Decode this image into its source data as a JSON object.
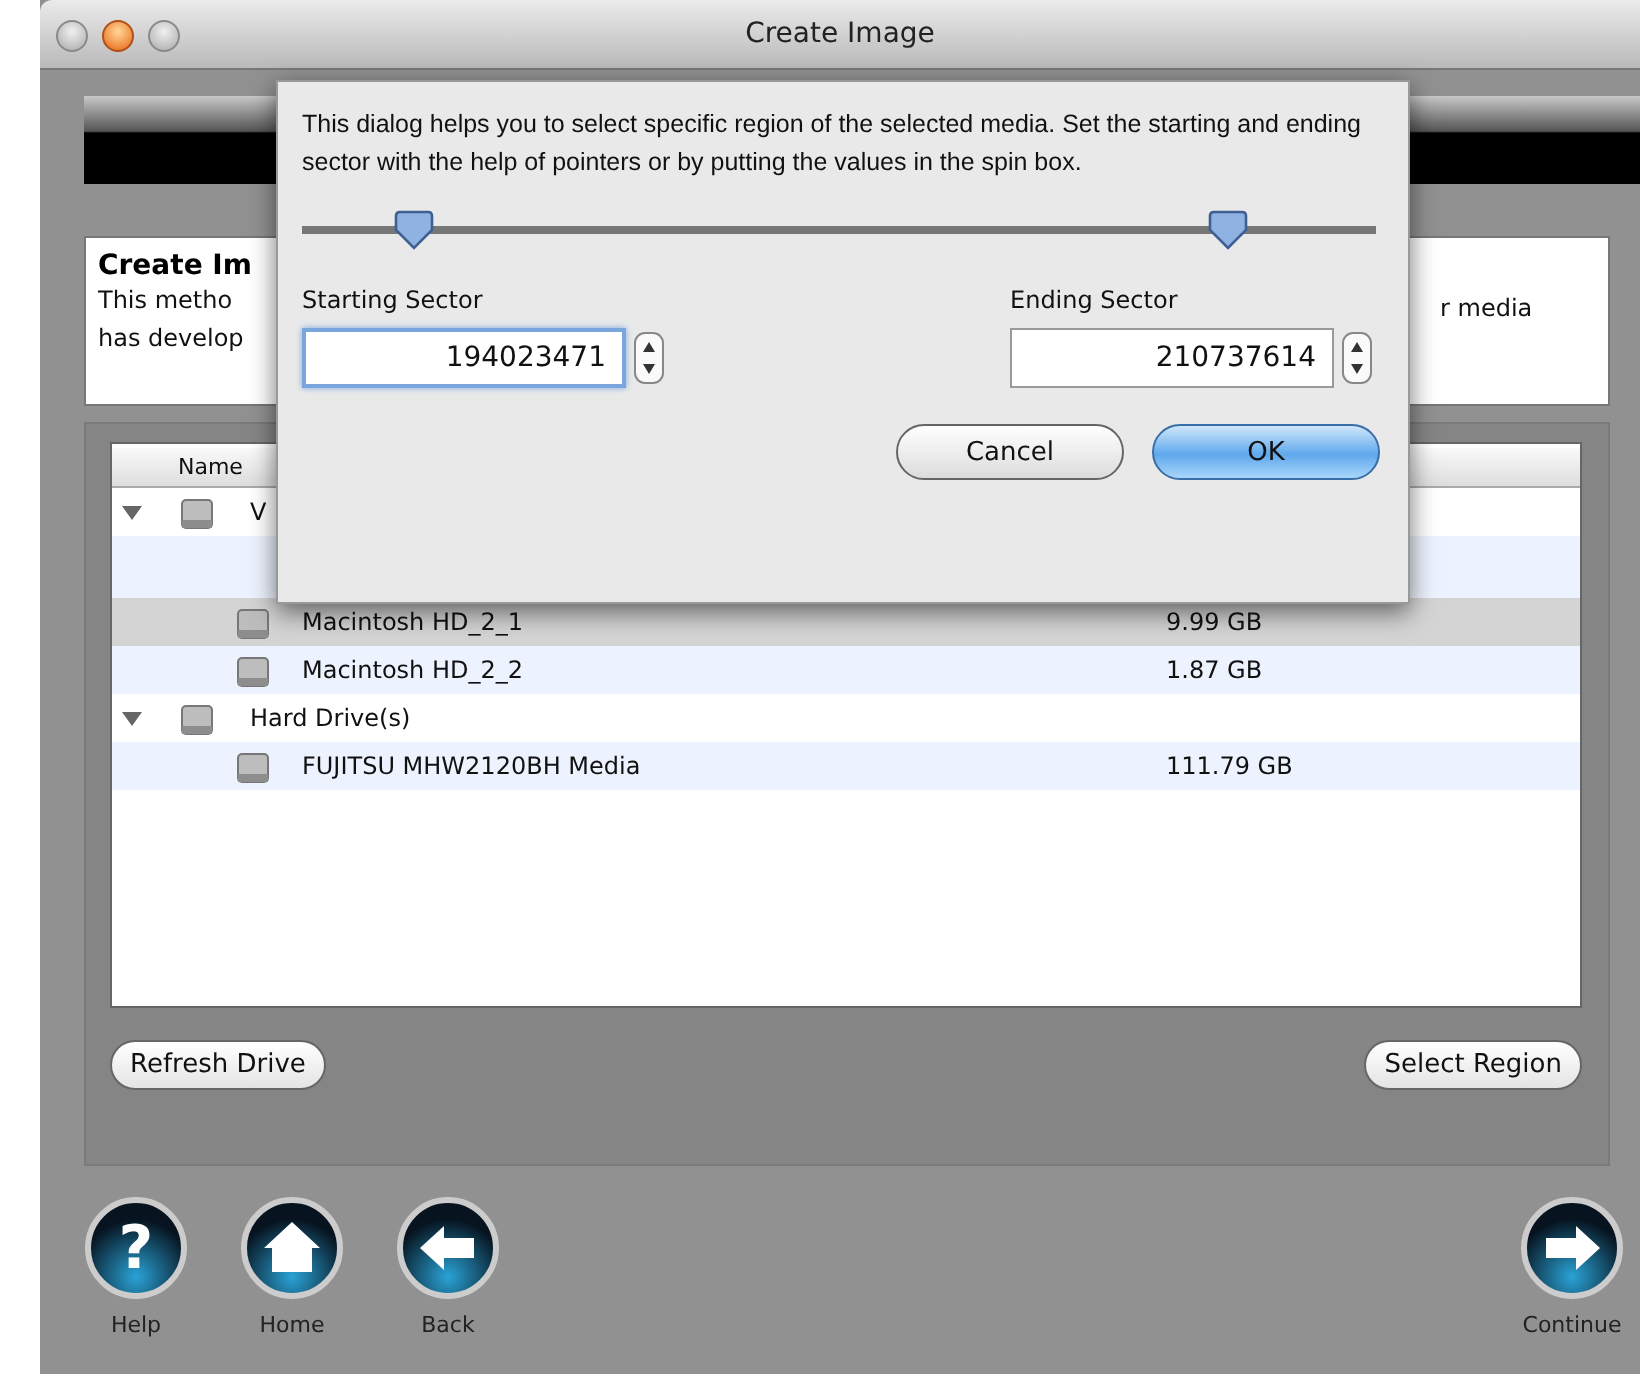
{
  "window": {
    "title": "Create Image"
  },
  "info": {
    "heading": "Create Im",
    "lines": [
      "This metho",
      "has develop"
    ],
    "right_text": "r media"
  },
  "table": {
    "columns": [
      "Name"
    ],
    "rows": [
      {
        "name": "V",
        "expanded": true,
        "selected": false,
        "children": [
          {
            "name": "Macintosh HD_2_1",
            "size": "9.99 GB",
            "selected": true
          },
          {
            "name": "Macintosh HD_2_2",
            "size": "1.87 GB",
            "selected": false
          }
        ]
      },
      {
        "name": "Hard Drive(s)",
        "expanded": true,
        "selected": false,
        "children": [
          {
            "name": "FUJITSU MHW2120BH Media",
            "size": "111.79 GB",
            "selected": false
          }
        ]
      }
    ]
  },
  "buttons": [
    "Refresh Drive",
    "Select Region"
  ],
  "nav": [
    {
      "label": "Help",
      "kind": "help",
      "glyph": "?"
    },
    {
      "label": "Home",
      "kind": "home"
    },
    {
      "label": "Back",
      "kind": "back"
    },
    {
      "label": "Continue",
      "kind": "continue"
    }
  ],
  "dialog": {
    "message": "This dialog helps you to select specific region of the selected media. Set the starting and ending sector with the help of pointers or by putting the values in the spin box.",
    "slider": {
      "thumbs": [
        {
          "level": 0.105
        },
        {
          "level": 0.863
        }
      ]
    },
    "fields": [
      {
        "label": "Starting Sector",
        "value": "194023471",
        "focused": true
      },
      {
        "label": "Ending Sector",
        "value": "210737614",
        "focused": false
      }
    ],
    "buttons": [
      {
        "label": "Cancel",
        "default": false
      },
      {
        "label": "OK",
        "default": true
      }
    ]
  }
}
